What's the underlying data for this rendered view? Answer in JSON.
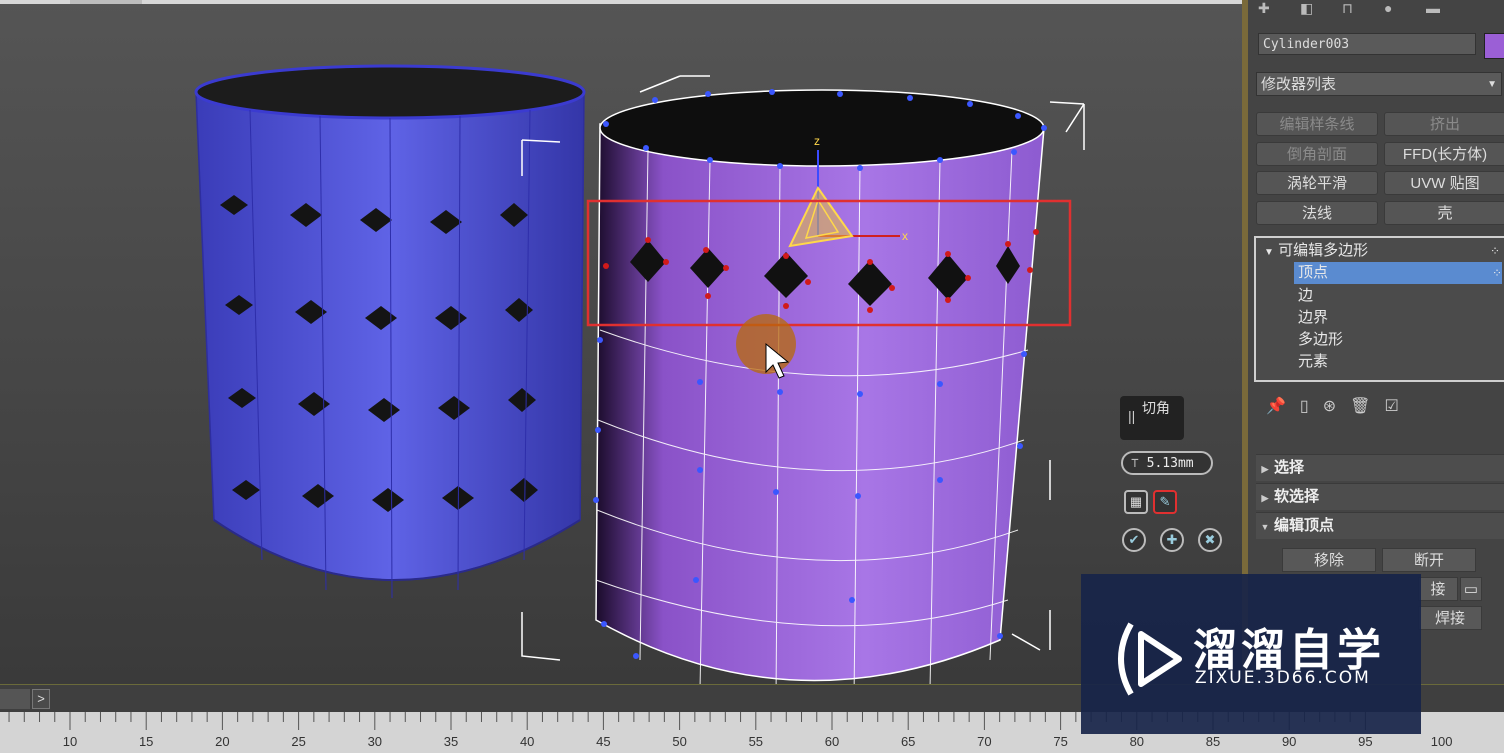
{
  "object": {
    "name": "Cylinder003",
    "color": "#9b5fd6"
  },
  "modifier_list": {
    "label": "修改器列表"
  },
  "modifier_buttons": [
    "编辑样条线",
    "挤出",
    "倒角剖面",
    "FFD(长方体)",
    "涡轮平滑",
    "UVW 贴图",
    "法线",
    "壳"
  ],
  "stack": {
    "root": "可编辑多边形",
    "items": [
      "顶点",
      "边",
      "边界",
      "多边形",
      "元素"
    ],
    "selected": "顶点"
  },
  "rollouts": {
    "select": "选择",
    "soft_select": "软选择",
    "edit_vertices": "编辑顶点"
  },
  "edit_vertex_buttons": {
    "remove": "移除",
    "break": "断开",
    "weld_partial": "接",
    "target_weld_partial": "焊接"
  },
  "caddy": {
    "title": "切角",
    "value": "5.13mm"
  },
  "gizmo": {
    "x_label": "x",
    "z_label": "z"
  },
  "timeline": {
    "next_label": ">"
  },
  "ruler": {
    "labels": [
      "10",
      "15",
      "20",
      "25",
      "30",
      "35",
      "40",
      "45",
      "50",
      "55",
      "60",
      "65",
      "70",
      "75",
      "80",
      "85",
      "90",
      "95",
      "100"
    ]
  },
  "watermark": {
    "brand": "溜溜自学",
    "site": "ZIXUE.3D66.COM"
  },
  "colors": {
    "blue_cylinder": "#5a5ee0",
    "purple_cylinder": "#a070e0",
    "selection_box": "#e03030"
  }
}
